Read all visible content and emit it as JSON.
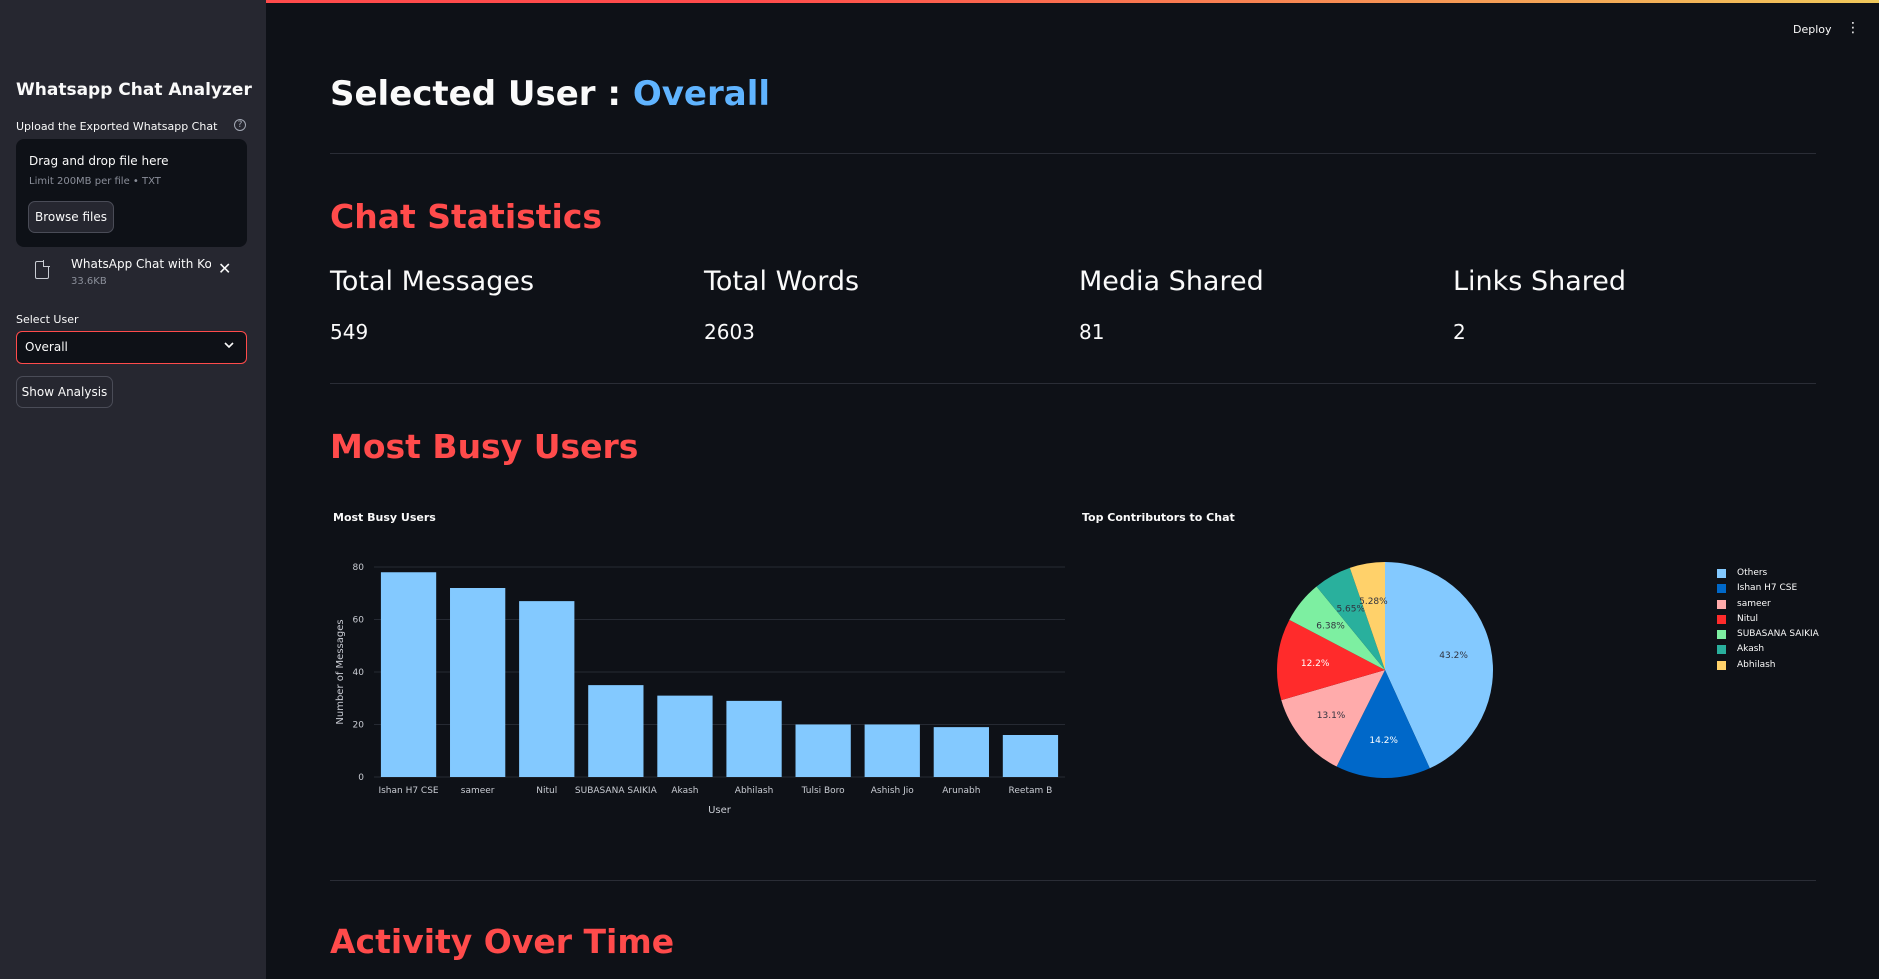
{
  "sidebar": {
    "title": "Whatsapp Chat Analyzer",
    "upload_label": "Upload the Exported Whatsapp Chat",
    "help_icon": "?",
    "dropzone_title": "Drag and drop file here",
    "dropzone_limit": "Limit 200MB per file • TXT",
    "browse_label": "Browse files",
    "file": {
      "name": "WhatsApp Chat with Ko...",
      "size": "33.6KB",
      "close": "✕"
    },
    "select_label": "Select User",
    "selected_user": "Overall",
    "chevron": "⌄",
    "show_label": "Show Analysis"
  },
  "header": {
    "deploy_label": "Deploy",
    "menu_glyph": "⋮"
  },
  "main": {
    "selected_prefix": "Selected User : ",
    "selected_value": "Overall",
    "stats_heading": "Chat Statistics",
    "metrics": [
      {
        "label": "Total Messages",
        "value": "549"
      },
      {
        "label": "Total Words",
        "value": "2603"
      },
      {
        "label": "Media Shared",
        "value": "81"
      },
      {
        "label": "Links Shared",
        "value": "2"
      }
    ],
    "busy_heading": "Most Busy Users",
    "activity_heading": "Activity Over Time"
  },
  "colors": {
    "accent": "#ff4b4b",
    "highlight": "#60b4ff",
    "bar": "#83c9ff"
  },
  "chart_data": [
    {
      "type": "bar",
      "title": "Most Busy Users",
      "xlabel": "User",
      "ylabel": "Number of Messages",
      "categories": [
        "Ishan H7 CSE",
        "sameer",
        "Nitul",
        "SUBASANA SAIKIA",
        "Akash",
        "Abhilash",
        "Tulsi Boro",
        "Ashish Jio",
        "Arunabh",
        "Reetam B"
      ],
      "values": [
        78,
        72,
        67,
        35,
        31,
        29,
        20,
        20,
        19,
        16
      ],
      "yticks": [
        0,
        20,
        40,
        60,
        80
      ],
      "ylim": [
        0,
        80
      ],
      "grid": true
    },
    {
      "type": "pie",
      "title": "Top Contributors to Chat",
      "legend_position": "right",
      "slices": [
        {
          "label": "Others",
          "value": 43.2,
          "text": "43.2%",
          "color": "#83c9ff"
        },
        {
          "label": "Ishan H7 CSE",
          "value": 14.2,
          "text": "14.2%",
          "color": "#0068c9"
        },
        {
          "label": "sameer",
          "value": 13.1,
          "text": "13.1%",
          "color": "#ffabab"
        },
        {
          "label": "Nitul",
          "value": 12.2,
          "text": "12.2%",
          "color": "#ff2b2b"
        },
        {
          "label": "SUBASANA SAIKIA",
          "value": 6.38,
          "text": "6.38%",
          "color": "#7defa1"
        },
        {
          "label": "Akash",
          "value": 5.65,
          "text": "5.65%",
          "color": "#29b09d"
        },
        {
          "label": "Abhilash",
          "value": 5.28,
          "text": "5.28%",
          "color": "#ffd16a"
        }
      ]
    }
  ]
}
